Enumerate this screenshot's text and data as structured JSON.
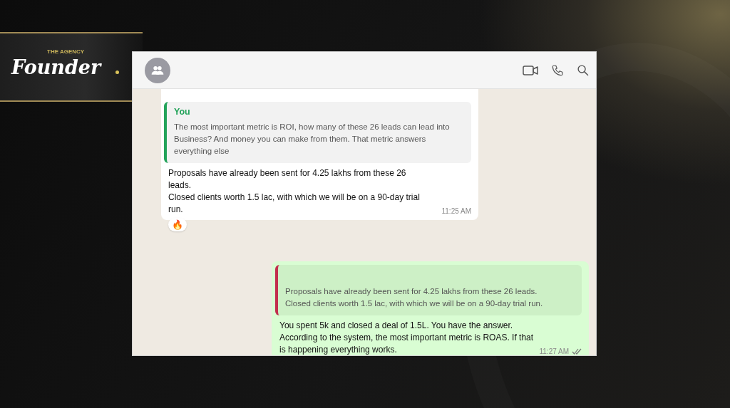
{
  "logo": {
    "tagline": "THE AGENCY",
    "name": "Founder"
  },
  "chat": {
    "messages": [
      {
        "kind": "incoming",
        "quote": {
          "author": "You",
          "color": "#23a35a",
          "text": "The most important metric is ROI, how many of these 26 leads can lead into Business? And money you can make from them. That metric answers everything else"
        },
        "text": "Proposals have already been sent for 4.25 lakhs from these 26 leads.\nClosed clients worth 1.5 lac, with which we will be on a 90-day trial run.",
        "time": "11:25 AM",
        "reaction": "🔥"
      },
      {
        "kind": "outgoing",
        "quote": {
          "color": "#c2304e",
          "text": "Proposals have already been sent for 4.25 lakhs from these 26 leads. Closed clients worth 1.5 lac, with which we will be on a 90-day trial run."
        },
        "text": "You spent 5k and closed a deal of 1.5L. You have the answer.\nAccording to the system, the most important metric is ROAS. If that is happening everything works.",
        "time": "11:27 AM",
        "read": true
      }
    ]
  }
}
